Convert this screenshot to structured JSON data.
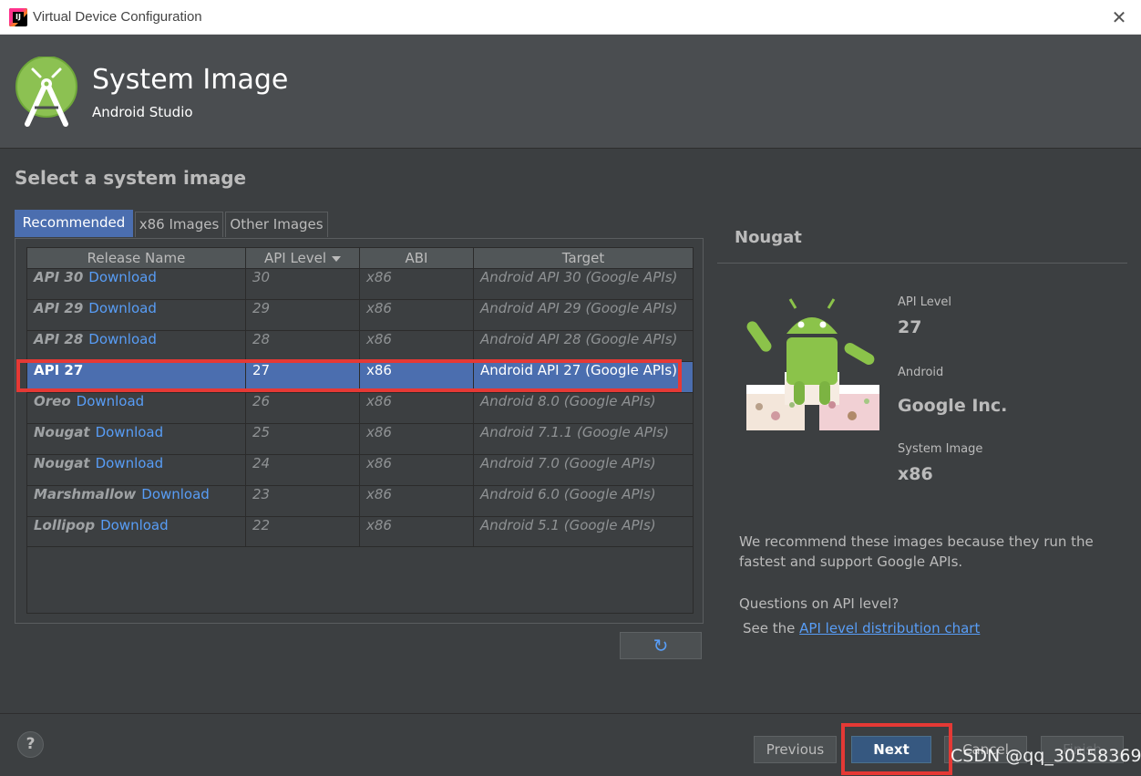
{
  "window": {
    "title": "Virtual Device Configuration",
    "app_icon_text": "IJ"
  },
  "header": {
    "title": "System Image",
    "subtitle": "Android Studio"
  },
  "section_title": "Select a system image",
  "tabs": [
    {
      "label": "Recommended",
      "active": true
    },
    {
      "label": "x86 Images",
      "active": false
    },
    {
      "label": "Other Images",
      "active": false
    }
  ],
  "table": {
    "columns": [
      "Release Name",
      "API Level",
      "ABI",
      "Target"
    ],
    "sorted_column": "API Level",
    "rows": [
      {
        "name": "API 30",
        "download": "Download",
        "api": "30",
        "abi": "x86",
        "target": "Android API 30 (Google APIs)",
        "selected": false
      },
      {
        "name": "API 29",
        "download": "Download",
        "api": "29",
        "abi": "x86",
        "target": "Android API 29 (Google APIs)",
        "selected": false
      },
      {
        "name": "API 28",
        "download": "Download",
        "api": "28",
        "abi": "x86",
        "target": "Android API 28 (Google APIs)",
        "selected": false
      },
      {
        "name": "API 27",
        "download": "",
        "api": "27",
        "abi": "x86",
        "target": "Android API 27 (Google APIs)",
        "selected": true
      },
      {
        "name": "Oreo",
        "download": "Download",
        "api": "26",
        "abi": "x86",
        "target": "Android 8.0 (Google APIs)",
        "selected": false
      },
      {
        "name": "Nougat",
        "download": "Download",
        "api": "25",
        "abi": "x86",
        "target": "Android 7.1.1 (Google APIs)",
        "selected": false
      },
      {
        "name": "Nougat",
        "download": "Download",
        "api": "24",
        "abi": "x86",
        "target": "Android 7.0 (Google APIs)",
        "selected": false
      },
      {
        "name": "Marshmallow",
        "download": "Download",
        "api": "23",
        "abi": "x86",
        "target": "Android 6.0 (Google APIs)",
        "selected": false
      },
      {
        "name": "Lollipop",
        "download": "Download",
        "api": "22",
        "abi": "x86",
        "target": "Android 5.1 (Google APIs)",
        "selected": false
      }
    ]
  },
  "refresh_icon": "refresh-icon",
  "detail": {
    "title": "Nougat",
    "api_level_label": "API Level",
    "api_level_value": "27",
    "android_label": "Android",
    "android_value": "Google Inc.",
    "system_image_label": "System Image",
    "system_image_value": "x86",
    "recommend_text": "We recommend these images because they run the fastest and support Google APIs.",
    "questions_text": "Questions on API level?",
    "see_the_text": "See the",
    "chart_link_text": "API level distribution chart"
  },
  "footer": {
    "help_label": "?",
    "previous_label": "Previous",
    "next_label": "Next",
    "cancel_label": "Cancel",
    "finish_label": "Finish"
  },
  "watermark": "CSDN @qq_30558369",
  "colors": {
    "accent": "#4b6eaf",
    "link": "#589df6",
    "highlight": "#e53935",
    "background": "#3c3f41"
  }
}
